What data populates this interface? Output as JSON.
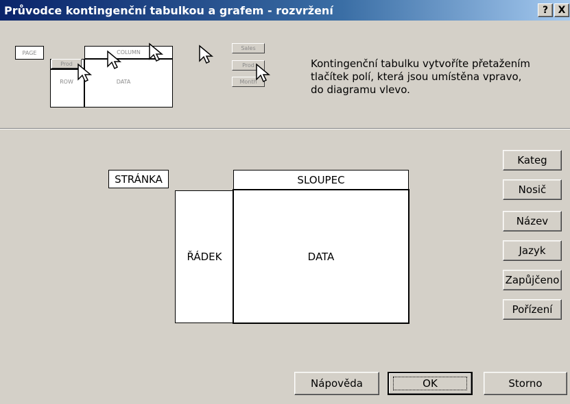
{
  "window": {
    "title": "Průvodce kontingenční tabulkou a grafem - rozvržení",
    "help_button": "?",
    "close_button": "X"
  },
  "illustration": {
    "page": "PAGE",
    "column": "COLUMN",
    "prod_row": "Prod",
    "row": "ROW",
    "data": "DATA",
    "btn_sales": "Sales",
    "btn_prod": "Prod",
    "btn_month": "Month"
  },
  "description": "Kontingenční tabulku vytvoříte přetažením tlačítek polí, která jsou umístěna vpravo, do diagramu vlevo.",
  "layout": {
    "page_label": "STRÁNKA",
    "column_label": "SLOUPEC",
    "row_label": "ŘÁDEK",
    "data_label": "DATA"
  },
  "fields": [
    "Kateg",
    "Nosič",
    "Název",
    "Jazyk",
    "Zapůjčeno",
    "Pořízení"
  ],
  "footer": {
    "help": "Nápověda",
    "ok": "OK",
    "cancel": "Storno"
  }
}
